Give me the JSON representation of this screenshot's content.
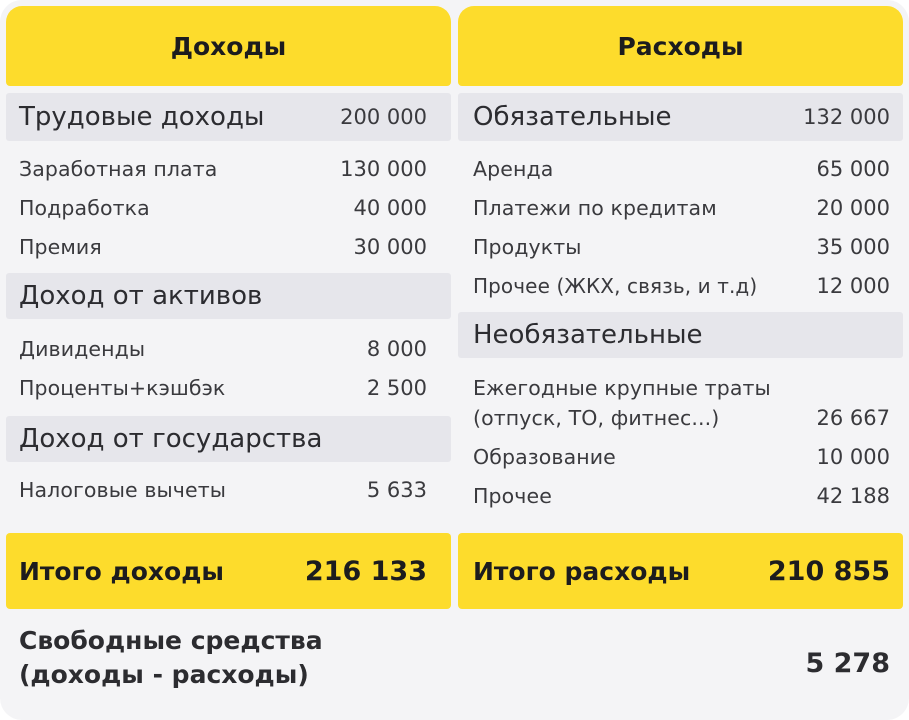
{
  "income": {
    "title": "Доходы",
    "sections": [
      {
        "label": "Трудовые доходы",
        "value": "200 000",
        "items": [
          {
            "label": "Заработная плата",
            "value": "130 000"
          },
          {
            "label": "Подработка",
            "value": "40 000"
          },
          {
            "label": "Премия",
            "value": "30 000"
          }
        ]
      },
      {
        "label": "Доход от активов",
        "value": "",
        "items": [
          {
            "label": "Дивиденды",
            "value": "8 000"
          },
          {
            "label": "Проценты+кэшбэк",
            "value": "2 500"
          }
        ]
      },
      {
        "label": "Доход от государства",
        "value": "",
        "items": [
          {
            "label": "Налоговые вычеты",
            "value": "5 633"
          }
        ]
      }
    ],
    "total_label": "Итого доходы",
    "total_value": "216 133"
  },
  "expenses": {
    "title": "Расходы",
    "sections": [
      {
        "label": "Обязательные",
        "value": "132 000",
        "items": [
          {
            "label": "Аренда",
            "value": "65 000"
          },
          {
            "label": "Платежи по кредитам",
            "value": "20 000"
          },
          {
            "label": "Продукты",
            "value": "35 000"
          },
          {
            "label": "Прочее (ЖКХ, связь, и т.д)",
            "value": "12 000"
          }
        ]
      },
      {
        "label": "Необязательные",
        "value": "",
        "items": [
          {
            "label_line1": "Ежегодные крупные траты",
            "label_line2": "(отпуск, ТО, фитнес...)",
            "value": "26 667"
          },
          {
            "label": "Образование",
            "value": "10 000"
          },
          {
            "label": "Прочее",
            "value": "42 188"
          }
        ]
      }
    ],
    "total_label": "Итого расходы",
    "total_value": "210 855"
  },
  "free_funds": {
    "label_line1": "Свободные средства",
    "label_line2": "(доходы - расходы)",
    "value": "5 278"
  },
  "colors": {
    "accent_yellow": "#fddc2c",
    "section_gray": "#e6e6eb",
    "card_background": "#f4f4f6"
  }
}
